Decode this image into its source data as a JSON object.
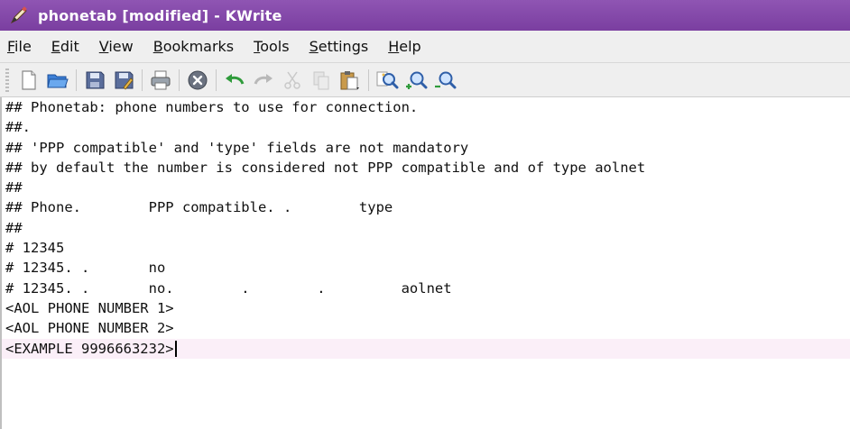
{
  "window": {
    "title": "phonetab [modified] - KWrite"
  },
  "menu": [
    {
      "mnemonic": "F",
      "rest": "ile"
    },
    {
      "mnemonic": "E",
      "rest": "dit"
    },
    {
      "mnemonic": "V",
      "rest": "iew"
    },
    {
      "mnemonic": "B",
      "rest": "ookmarks"
    },
    {
      "mnemonic": "T",
      "rest": "ools"
    },
    {
      "mnemonic": "S",
      "rest": "ettings"
    },
    {
      "mnemonic": "H",
      "rest": "elp"
    }
  ],
  "toolbar": [
    "new-document-icon",
    "open-icon",
    "save-icon",
    "save-as-icon",
    "print-icon",
    "close-icon",
    "undo-icon",
    "redo-icon",
    "cut-icon",
    "copy-icon",
    "paste-icon",
    "find-icon",
    "find-next-icon",
    "find-previous-icon"
  ],
  "editor": {
    "lines": [
      "## Phonetab: phone numbers to use for connection.",
      "##.",
      "## 'PPP compatible' and 'type' fields are not mandatory",
      "## by default the number is considered not PPP compatible and of type aolnet",
      "##",
      "## Phone.        PPP compatible. .        type",
      "##",
      "# 12345",
      "# 12345. .       no",
      "# 12345. .       no.        .        .         aolnet",
      "<AOL PHONE NUMBER 1>",
      "<AOL PHONE NUMBER 2>",
      "<EXAMPLE 9996663232>"
    ]
  }
}
